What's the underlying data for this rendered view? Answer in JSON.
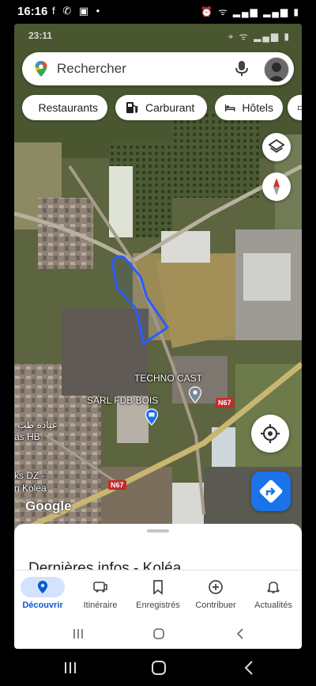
{
  "outer_status": {
    "time": "16:16",
    "left_icons": "f ✆ ▣ •",
    "right_icons": "⏰ ᯤ ▂▄▆ ▂▄▆ ▮"
  },
  "inner_status": {
    "time": "23:11",
    "right_icons": "⌖ ᯤ ▂▄▆ ▮"
  },
  "search": {
    "placeholder": "Rechercher"
  },
  "chips": [
    {
      "label": "Restaurants",
      "icon": "fork-knife-icon"
    },
    {
      "label": "Carburant",
      "icon": "fuel-pump-icon"
    },
    {
      "label": "Hôtels",
      "icon": "bed-icon"
    }
  ],
  "map_labels": {
    "techno_cast": "TECHNO CAST",
    "sarl_fdb_bois": "SARL FDB BOIS",
    "road_n67_a": "N67",
    "road_n67_b": "N67",
    "arabic_fragment": "عيادة طب",
    "hb_fragment": "as HB",
    "dz_fragment": "ks DZ -",
    "kolea_fragment": "n Kolea",
    "google": "Google"
  },
  "sheet": {
    "title": "Dernières infos - Koléa"
  },
  "nav": {
    "items": [
      {
        "label": "Découvrir",
        "icon": "location-pin-icon",
        "active": true
      },
      {
        "label": "Itinéraire",
        "icon": "car-icon",
        "active": false
      },
      {
        "label": "Enregistrés",
        "icon": "bookmark-icon",
        "active": false
      },
      {
        "label": "Contribuer",
        "icon": "add-circle-icon",
        "active": false
      },
      {
        "label": "Actualités",
        "icon": "bell-icon",
        "active": false
      }
    ]
  },
  "colors": {
    "accent": "#1a73e8",
    "polygon": "#2a5cff",
    "road_shield": "#c62828"
  }
}
